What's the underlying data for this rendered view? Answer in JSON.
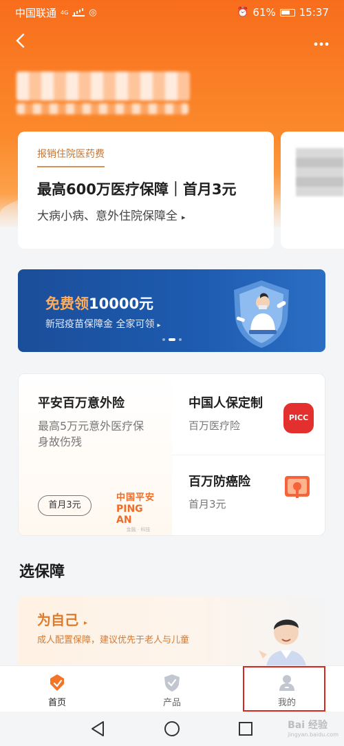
{
  "status": {
    "carrier": "中国联通",
    "network": "4G",
    "battery": "61%",
    "time": "15:37"
  },
  "nav": {
    "back_icon": "back-arrow",
    "more_icon": "more-dots"
  },
  "main_card": {
    "tag": "报销住院医药费",
    "title": "最高600万医疗保障｜首月3元",
    "subtitle": "大病小病、意外住院保障全",
    "arrow": "▸"
  },
  "banner": {
    "title_highlight": "免费领",
    "title_rest": "10000元",
    "subtitle": "新冠疫苗保障金 全家可领",
    "arrow": "▸"
  },
  "products": {
    "left": {
      "title": "平安百万意外险",
      "desc": "最高5万元意外医疗保身故伤残",
      "pill": "首月3元",
      "logo_cn": "中国平安",
      "logo_en": "PING AN",
      "logo_tiny": "金融 · 科技"
    },
    "right_top": {
      "title": "中国人保定制",
      "desc": "百万医疗险",
      "badge": "PICC"
    },
    "right_bottom": {
      "title": "百万防癌险",
      "desc": "首月3元"
    }
  },
  "section": {
    "title": "选保障",
    "self_title": "为自己",
    "self_arrow": "▸",
    "self_sub": "成人配置保障，建议优先于老人与儿童"
  },
  "tabs": [
    {
      "label": "首页",
      "icon": "home-diamond-icon",
      "active": true
    },
    {
      "label": "产品",
      "icon": "shield-check-icon",
      "active": false
    },
    {
      "label": "我的",
      "icon": "user-icon",
      "active": false
    }
  ],
  "watermark": {
    "text": "Bai 经验",
    "sub": "jingyan.baidu.com"
  },
  "colors": {
    "brand_orange": "#f86d1c",
    "highlight_box": "#d9261c",
    "banner_blue": "#1d5aae"
  }
}
